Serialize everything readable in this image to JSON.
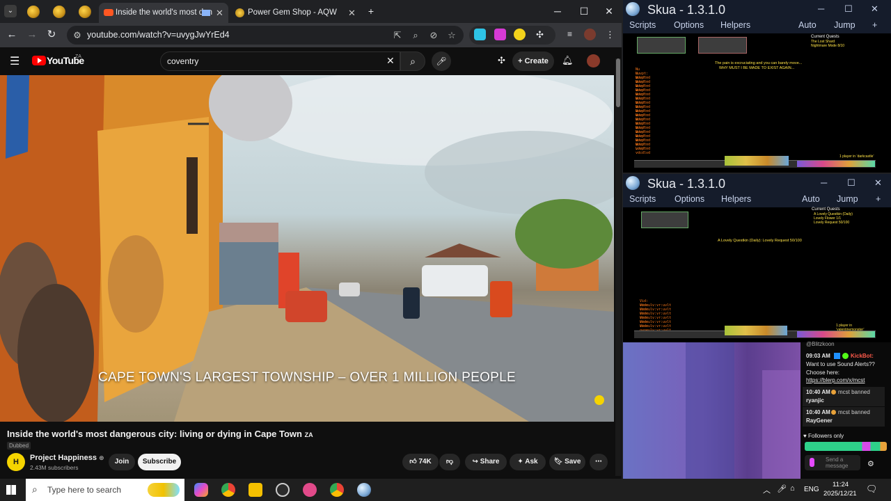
{
  "browser": {
    "tabs": [
      {
        "label": "Inside the world's most dan",
        "active": true
      },
      {
        "label": "Power Gem Shop - AQW",
        "active": false
      }
    ],
    "url": "youtube.com/watch?v=uvygJwYrEd4"
  },
  "youtube": {
    "logo_text": "YouTube",
    "country_code": "ZA",
    "search_query": "coventry",
    "create_label": "Create",
    "caption": "CAPE TOWN'S LARGEST TOWNSHIP – OVER 1 MILLION PEOPLE",
    "video_title": "Inside the world's most dangerous city: living or dying in Cape Town",
    "title_badge": "ZA",
    "dubbed_label": "Dubbed",
    "channel_initial": "H",
    "channel_name": "Project Happiness",
    "subscribers": "2.43M subscribers",
    "join_label": "Join",
    "subscribe_label": "Subscribe",
    "like_count": "74K",
    "share_label": "Share",
    "ask_label": "Ask",
    "save_label": "Save"
  },
  "skua_top": {
    "title": "Skua - 1.3.1.0",
    "menu": [
      "Scripts",
      "Options",
      "Helpers",
      "Auto",
      "Jump"
    ],
    "quest_header": "Current Quests",
    "quest_line1": "The Lost Shard",
    "quest_line2": "Nightmare Mode 8/10",
    "game_message1": "The pain is excruciating and you can barely move...",
    "game_message2": "WHY MUST I BE MADE TO EXIST AGAIN...",
    "log_line": "Nu Luvpt: vdcdlvd",
    "footer_line": "1 player in ‘darkcastle’"
  },
  "skua_bottom": {
    "title": "Skua - 1.3.1.0",
    "menu": [
      "Scripts",
      "Options",
      "Helpers",
      "Auto",
      "Jump"
    ],
    "quest_header": "Current Quests",
    "quest_line1": "A Lovely Questkin (Daily)",
    "quest_line2": "Lovely Flower 1/1",
    "quest_line3": "Lovely Request 50/100",
    "game_message": "A Lovely Questkin (Daily): Lovely Request 50/100",
    "log_line": "Vid: ovoeulv:vr:uvlt",
    "footer_line": "1 player in ‘valentinemonster’"
  },
  "chat": {
    "top_fragment": "@Blitzkoon",
    "msg1_time": "09:03 AM",
    "msg1_user": "KickBot:",
    "msg1_text": "Want to use Sound Alerts?? Choose here:",
    "msg1_link": "https://blerp.com/x/mcst",
    "msg2_time": "10:40 AM",
    "msg2_mod": "mcst banned",
    "msg2_user": "ryanjic",
    "msg3_time": "10:40 AM",
    "msg3_mod": "mcst banned",
    "msg3_user": "RayGener",
    "followers_only": "Followers only",
    "send_placeholder": "Send a message"
  },
  "taskbar": {
    "search_placeholder": "Type here to search",
    "lang": "ENG",
    "time": "11:24",
    "date": "2025/12/21"
  },
  "colors": {
    "youtube_red": "#ff0000",
    "skua_bar": "#151c2b",
    "kick_green": "#53fc18",
    "log_orange": "#ff7a1a"
  }
}
